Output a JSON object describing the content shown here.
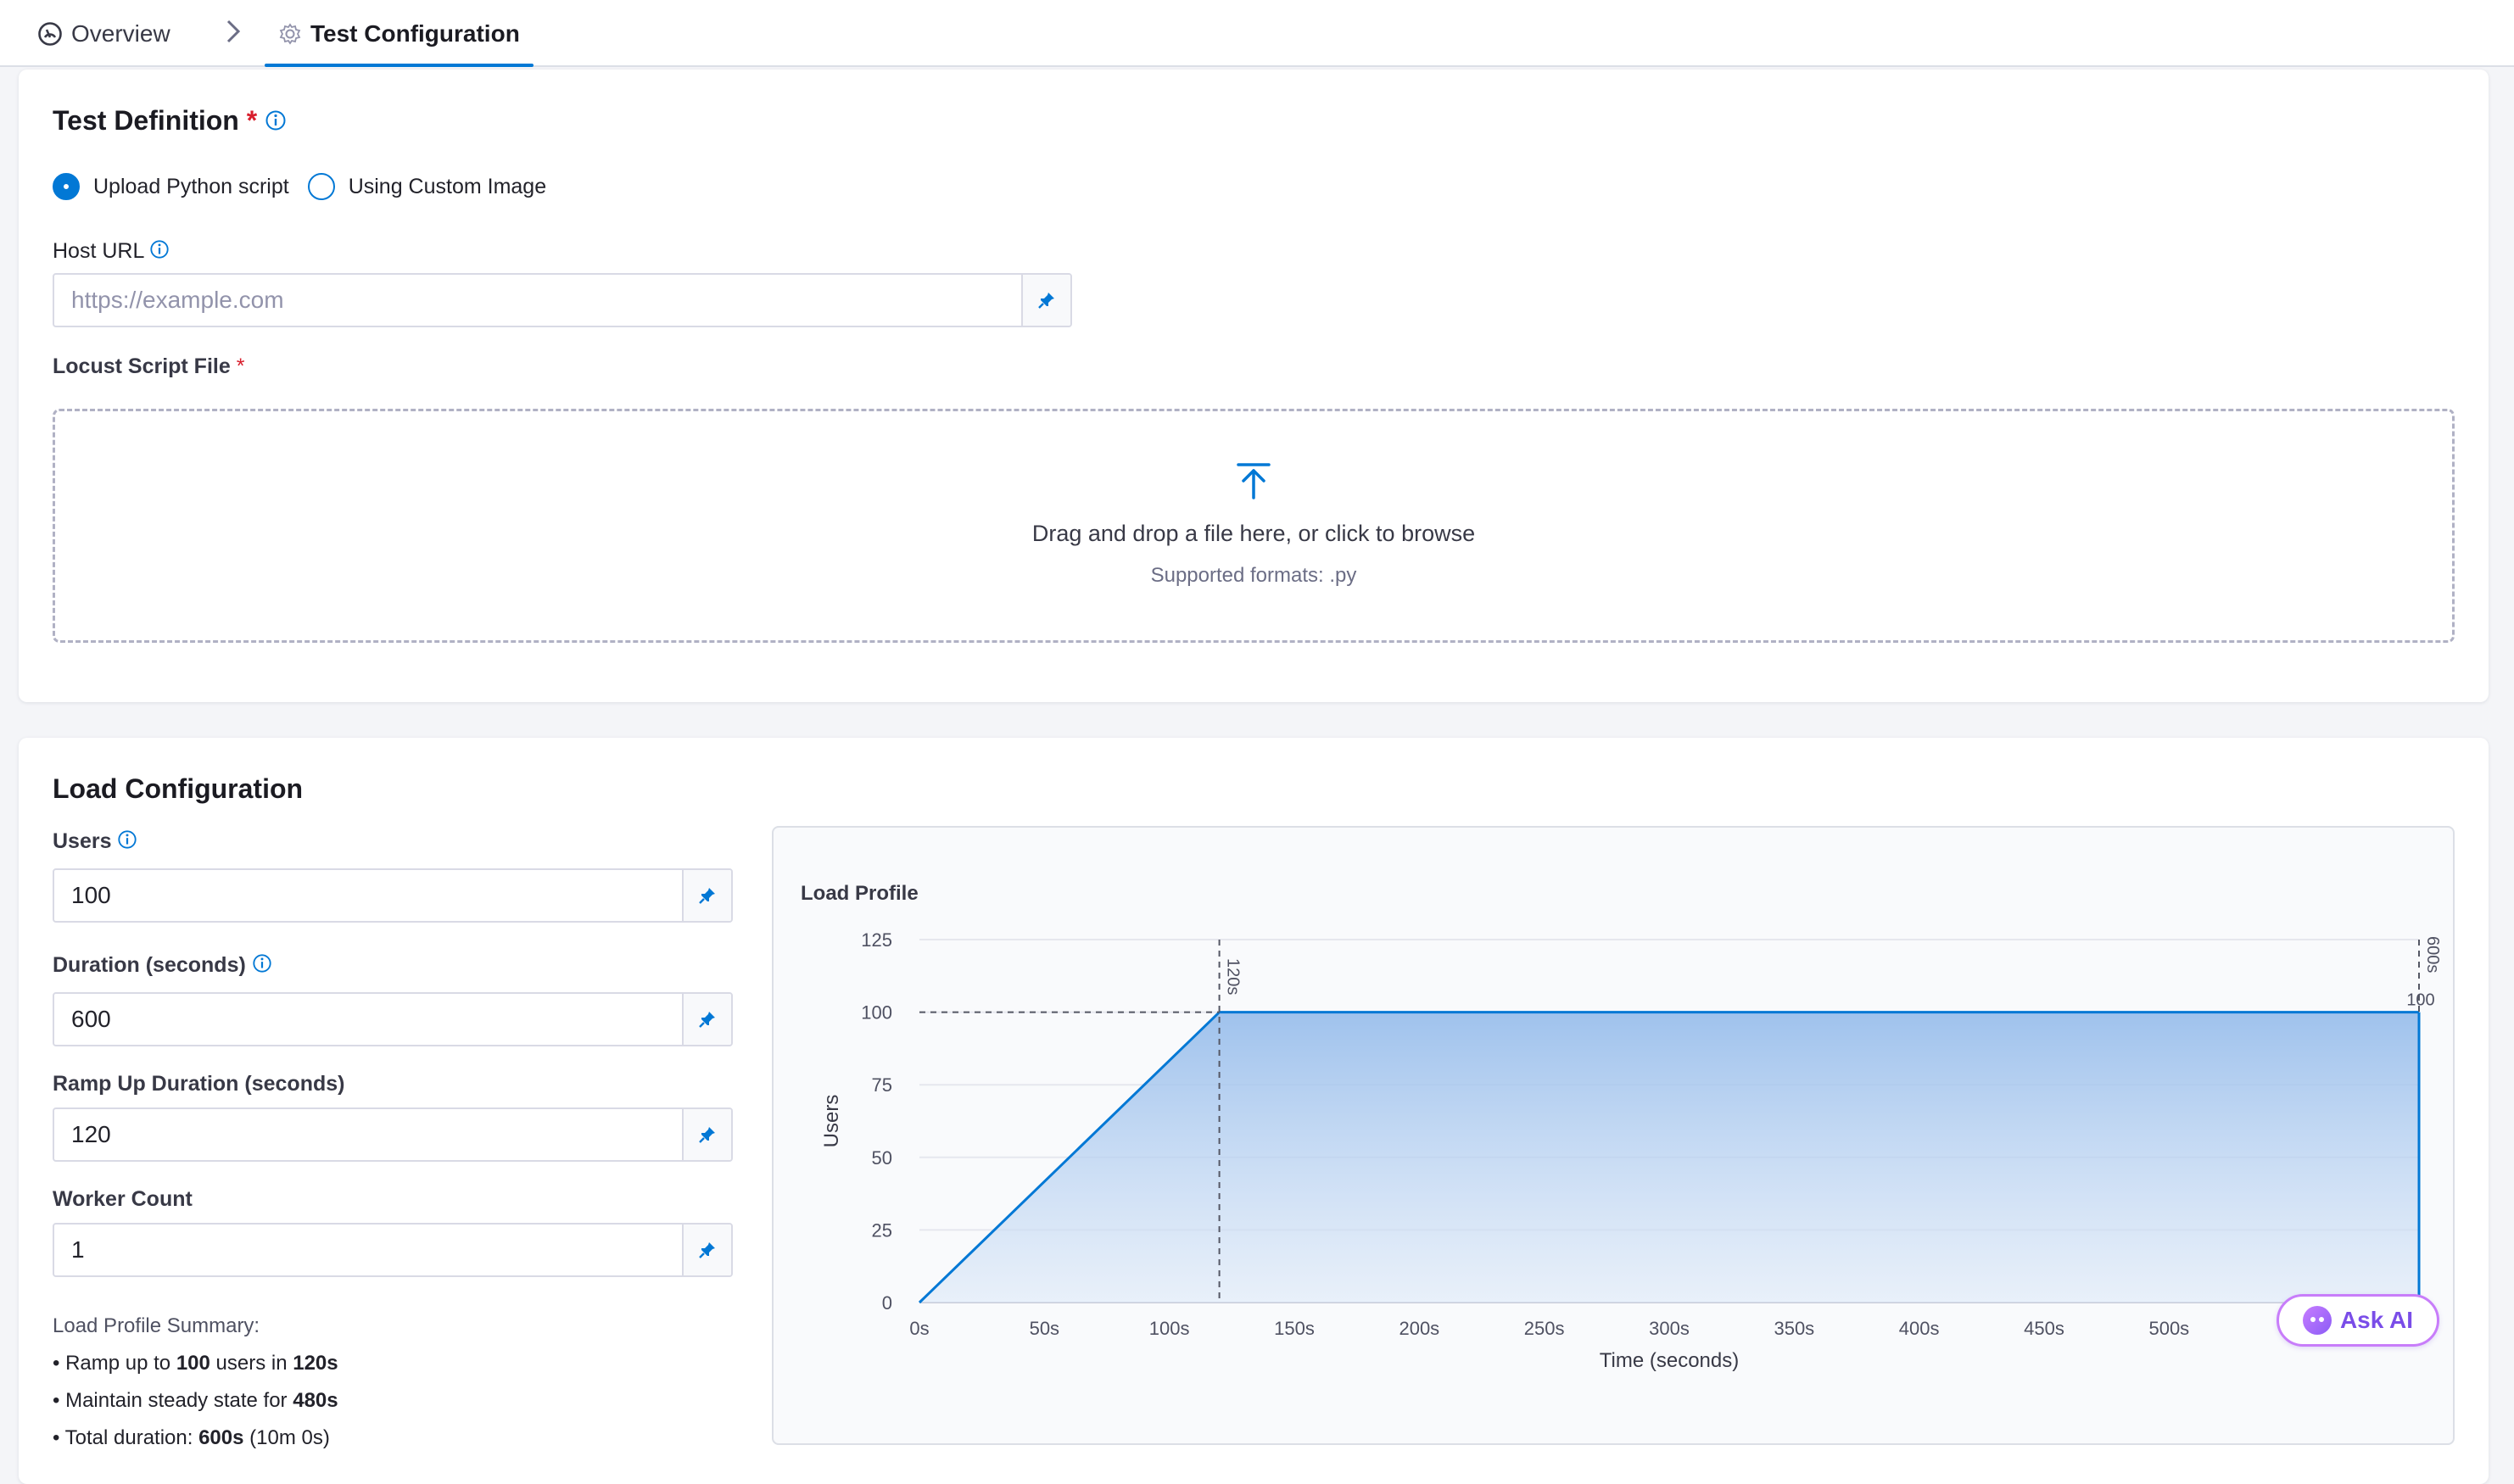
{
  "tabs": {
    "overview": "Overview",
    "test_configuration": "Test Configuration"
  },
  "test_definition": {
    "title": "Test Definition",
    "required_mark": "*",
    "options": [
      "Upload Python script",
      "Using Custom Image"
    ],
    "selected_option": "Upload Python script",
    "host_url": {
      "label": "Host URL",
      "value": "",
      "placeholder": "https://example.com"
    },
    "script_file": {
      "label": "Locust Script File",
      "required_mark": "*",
      "drop_text": "Drag and drop a file here, or click to browse",
      "formats": "Supported formats: .py"
    }
  },
  "load_configuration": {
    "title": "Load Configuration",
    "fields": [
      {
        "label": "Users",
        "value": "100"
      },
      {
        "label": "Duration (seconds)",
        "value": "600"
      },
      {
        "label": "Ramp Up Duration (seconds)",
        "value": "120"
      },
      {
        "label": "Worker Count",
        "value": "1"
      }
    ],
    "summary": {
      "head": "Load Profile Summary:",
      "line1": {
        "prefix": "• Ramp up to ",
        "users": "100",
        "mid": " users in ",
        "ramp": "120s"
      },
      "line2": {
        "prefix": "• Maintain steady state for ",
        "value": "480s"
      },
      "line3": {
        "prefix": "• Total duration: ",
        "value": "600s",
        "suffix": " (10m 0s)"
      }
    }
  },
  "chart_data": {
    "type": "area",
    "title": "Load Profile",
    "xlabel": "Time (seconds)",
    "ylabel": "Users",
    "xlim": [
      0,
      600
    ],
    "ylim": [
      0,
      125
    ],
    "x_ticks": [
      "0s",
      "50s",
      "100s",
      "150s",
      "200s",
      "250s",
      "300s",
      "350s",
      "400s",
      "450s",
      "500s",
      "5"
    ],
    "y_ticks": [
      "0",
      "25",
      "50",
      "75",
      "100",
      "125"
    ],
    "x": [
      0,
      120,
      600
    ],
    "y": [
      0,
      100,
      100
    ],
    "annotations": [
      {
        "label": "120s",
        "x": 120
      },
      {
        "label": "600s",
        "x": 600
      },
      {
        "label": "100",
        "x": 600,
        "y": 100
      }
    ],
    "grid": true,
    "color": "#0278d5"
  },
  "ask_ai": {
    "label": "Ask AI"
  }
}
